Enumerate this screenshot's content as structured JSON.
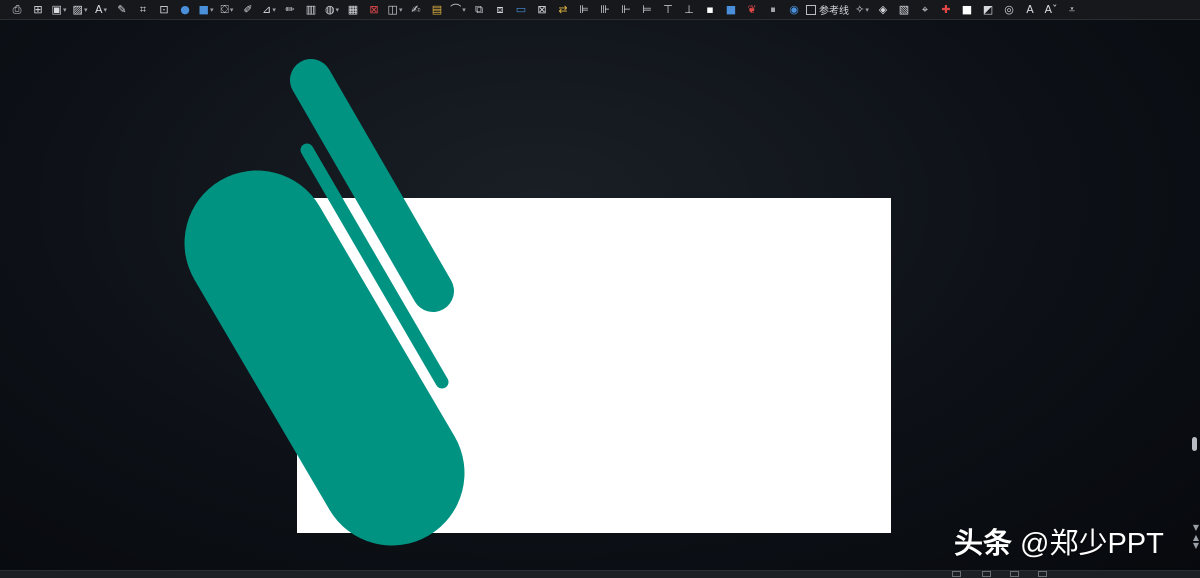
{
  "toolbar": {
    "items": [
      {
        "icon": "print-icon",
        "glyph": "⎙"
      },
      {
        "icon": "align-center-icon",
        "glyph": "⊞"
      },
      {
        "icon": "frame-icon",
        "glyph": "▣",
        "caret": true
      },
      {
        "icon": "picture-icon",
        "glyph": "▨",
        "caret": true
      },
      {
        "icon": "font-color-icon",
        "glyph": "A",
        "caret": true
      },
      {
        "icon": "pen-icon",
        "glyph": "✎"
      },
      {
        "icon": "crop-icon",
        "glyph": "⌗"
      },
      {
        "icon": "crop-fit-icon",
        "glyph": "⊡"
      },
      {
        "icon": "blue-circle-icon",
        "glyph": "●",
        "color": "blue"
      },
      {
        "icon": "fill-color-icon",
        "glyph": "■",
        "color": "blue",
        "caret": true
      },
      {
        "icon": "fill-bucket-icon",
        "glyph": "⛋",
        "caret": true
      },
      {
        "icon": "eyedropper-icon",
        "glyph": "✐"
      },
      {
        "icon": "outline-icon",
        "glyph": "⊿",
        "caret": true
      },
      {
        "icon": "pencil-icon",
        "glyph": "✏"
      },
      {
        "icon": "chart-icon",
        "glyph": "▥"
      },
      {
        "icon": "shapes-icon",
        "glyph": "◍",
        "caret": true
      },
      {
        "icon": "table-icon",
        "glyph": "▦"
      },
      {
        "icon": "pdf-icon",
        "glyph": "⊠",
        "color": "red"
      },
      {
        "icon": "shape-icon",
        "glyph": "◫",
        "caret": true
      },
      {
        "icon": "format-painter-icon",
        "glyph": "✍"
      },
      {
        "icon": "note-icon",
        "glyph": "▤",
        "color": "gold"
      },
      {
        "icon": "freeform-icon",
        "glyph": "⌒",
        "caret": true
      },
      {
        "icon": "bring-forward-icon",
        "glyph": "⧉"
      },
      {
        "icon": "send-backward-icon",
        "glyph": "⧈"
      },
      {
        "icon": "image-icon",
        "glyph": "▭",
        "color": "blue"
      },
      {
        "icon": "placeholder-icon",
        "glyph": "⊠"
      },
      {
        "icon": "replace-image-icon",
        "glyph": "⇄",
        "color": "gold"
      },
      {
        "icon": "align-left-icon",
        "glyph": "⊫"
      },
      {
        "icon": "align-right-icon",
        "glyph": "⊪"
      },
      {
        "icon": "align-middle-icon",
        "glyph": "⊩"
      },
      {
        "icon": "distribute-h-icon",
        "glyph": "⊨"
      },
      {
        "icon": "align-top-icon",
        "glyph": "⊤"
      },
      {
        "icon": "align-bottom-icon",
        "glyph": "⊥"
      },
      {
        "icon": "small-square-icon",
        "glyph": "▪",
        "color": "white"
      },
      {
        "icon": "blue-square-icon",
        "glyph": "■",
        "color": "blue"
      },
      {
        "icon": "brush-icon",
        "glyph": "❦",
        "color": "red"
      },
      {
        "icon": "pause-icon",
        "glyph": "⏸"
      },
      {
        "icon": "globe-icon",
        "glyph": "◉",
        "color": "blue"
      }
    ],
    "guides_label": "参考线",
    "items_right": [
      {
        "icon": "star-icon",
        "glyph": "✧",
        "caret": true
      },
      {
        "icon": "diamond-icon",
        "glyph": "◈"
      },
      {
        "icon": "image-adjust-icon",
        "glyph": "▧"
      },
      {
        "icon": "crop-marks-icon",
        "glyph": "⌖"
      },
      {
        "icon": "red-cross-icon",
        "glyph": "✚",
        "color": "red"
      },
      {
        "icon": "white-square-icon",
        "glyph": "■",
        "color": "white"
      },
      {
        "icon": "shadow-square-icon",
        "glyph": "◩"
      },
      {
        "icon": "merge-shapes-icon",
        "glyph": "◎"
      },
      {
        "icon": "font-increase-icon",
        "glyph": "A"
      },
      {
        "icon": "font-decrease-icon",
        "glyph": "Aˇ"
      },
      {
        "icon": "more-icon",
        "glyph": "⩡"
      }
    ]
  },
  "colors": {
    "slide_background": "#ffffff",
    "shape_fill": "#009382",
    "app_background": "#0d1117"
  },
  "watermark": {
    "source": "头条",
    "handle": "@郑少PPT"
  }
}
